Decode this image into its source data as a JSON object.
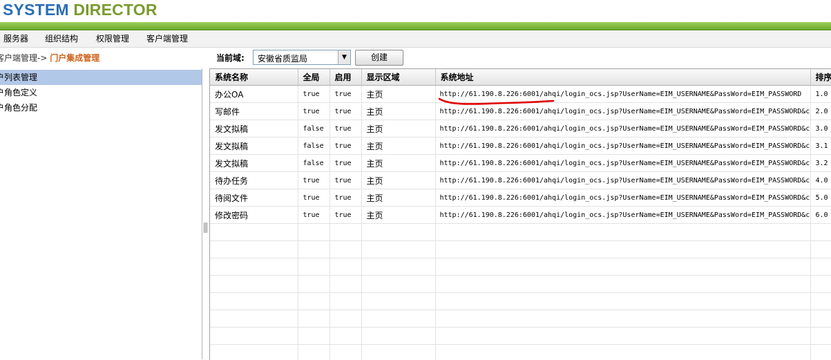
{
  "brand": {
    "part1": "SYSTEM",
    "part2": "DIRECTOR"
  },
  "menu": [
    "服务器",
    "组织结构",
    "权限管理",
    "客户端管理"
  ],
  "breadcrumb": {
    "parent": "客户端管理->",
    "current": "门户集成管理"
  },
  "toolbar": {
    "domain_label": "当前域:",
    "domain_value": "安徽省质监局",
    "create_button": "创建"
  },
  "sidebar": {
    "items": [
      "户列表管理",
      "户角色定义",
      "户角色分配"
    ]
  },
  "grid": {
    "columns": [
      "系统名称",
      "全局",
      "启用",
      "显示区域",
      "系统地址",
      "排序"
    ],
    "rows": [
      {
        "name": "办公OA",
        "global": "true",
        "enabled": "true",
        "area": "主页",
        "url": "http://61.190.8.226:6001/ahqi/login_ocs.jsp?UserName=EIM_USERNAME&PassWord=EIM_PASSWORD",
        "order": "1.0"
      },
      {
        "name": "写邮件",
        "global": "true",
        "enabled": "true",
        "area": "主页",
        "url": "http://61.190.8.226:6001/ahqi/login_ocs.jsp?UserName=EIM_USERNAME&PassWord=EIM_PASSWORD&c",
        "order": "2.0"
      },
      {
        "name": "发文拟稿",
        "global": "false",
        "enabled": "true",
        "area": "主页",
        "url": "http://61.190.8.226:6001/ahqi/login_ocs.jsp?UserName=EIM_USERNAME&PassWord=EIM_PASSWORD&c",
        "order": "3.0"
      },
      {
        "name": "发文拟稿",
        "global": "false",
        "enabled": "true",
        "area": "主页",
        "url": "http://61.190.8.226:6001/ahqi/login_ocs.jsp?UserName=EIM_USERNAME&PassWord=EIM_PASSWORD&c",
        "order": "3.1"
      },
      {
        "name": "发文拟稿",
        "global": "false",
        "enabled": "true",
        "area": "主页",
        "url": "http://61.190.8.226:6001/ahqi/login_ocs.jsp?UserName=EIM_USERNAME&PassWord=EIM_PASSWORD&c",
        "order": "3.2"
      },
      {
        "name": "待办任务",
        "global": "true",
        "enabled": "true",
        "area": "主页",
        "url": "http://61.190.8.226:6001/ahqi/login_ocs.jsp?UserName=EIM_USERNAME&PassWord=EIM_PASSWORD&c",
        "order": "4.0"
      },
      {
        "name": "待阅文件",
        "global": "true",
        "enabled": "true",
        "area": "主页",
        "url": "http://61.190.8.226:6001/ahqi/login_ocs.jsp?UserName=EIM_USERNAME&PassWord=EIM_PASSWORD&c",
        "order": "5.0"
      },
      {
        "name": "修改密码",
        "global": "true",
        "enabled": "true",
        "area": "主页",
        "url": "http://61.190.8.226:6001/ahqi/login_ocs.jsp?UserName=EIM_USERNAME&PassWord=EIM_PASSWORD&c",
        "order": "6.0"
      }
    ]
  },
  "colors": {
    "brand_blue": "#2a6fb5",
    "brand_green": "#7a9a2e",
    "breadcrumb_current": "#d0621b",
    "sidebar_selected": "#b2c8e8",
    "annotation_stroke": "#e00000"
  }
}
